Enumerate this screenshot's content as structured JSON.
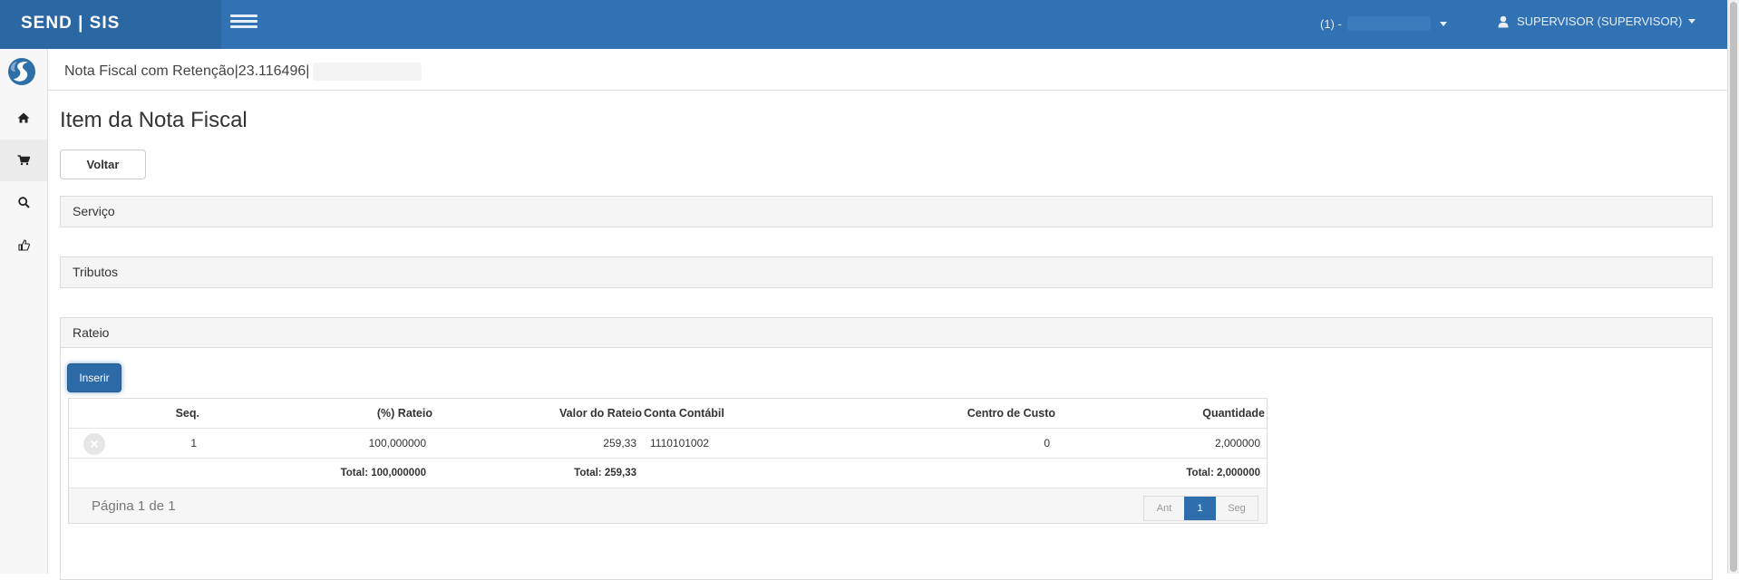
{
  "header": {
    "brand": "SEND | SIS",
    "company_prefix": "(1) -",
    "user_label": "SUPERVISOR (SUPERVISOR)"
  },
  "sidebar": {
    "items": [
      {
        "icon": "home-icon"
      },
      {
        "icon": "cart-icon"
      },
      {
        "icon": "search-icon"
      },
      {
        "icon": "thumbs-up-icon"
      }
    ]
  },
  "breadcrumb": "Nota Fiscal com Retenção|23.116496|",
  "page": {
    "title": "Item da Nota Fiscal",
    "back_label": "Voltar"
  },
  "panels": {
    "servico": "Serviço",
    "tributos": "Tributos",
    "rateio": "Rateio"
  },
  "rateio": {
    "insert_label": "Inserir",
    "columns": {
      "seq": "Seq.",
      "percent": "(%) Rateio",
      "valor": "Valor do Rateio",
      "conta": "Conta Contábil",
      "centro": "Centro de Custo",
      "quantidade": "Quantidade"
    },
    "rows": [
      {
        "seq": "1",
        "percent": "100,000000",
        "valor": "259,33",
        "conta": "1110101002",
        "centro": "0",
        "quantidade": "2,000000"
      }
    ],
    "totals": {
      "percent": "Total: 100,000000",
      "valor": "Total: 259,33",
      "quantidade": "Total: 2,000000"
    },
    "pager": {
      "info": "Página 1 de 1",
      "prev": "Ant",
      "current": "1",
      "next": "Seg"
    }
  },
  "colors": {
    "topbar": "#3072b3",
    "brand_bg": "#2b67a3",
    "primary_button": "#2c6aa8"
  }
}
